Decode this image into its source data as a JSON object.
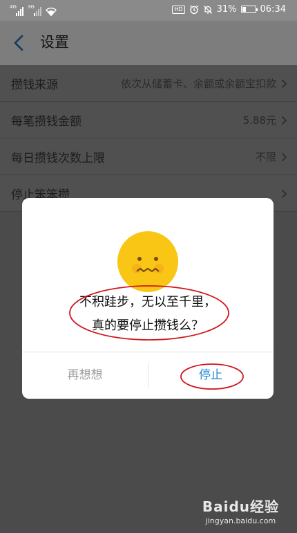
{
  "status_bar": {
    "sim1": "4G",
    "sim2": "3G",
    "hd": "HD",
    "battery_percent": "31%",
    "battery_level": 0.31,
    "time": "06:34"
  },
  "header": {
    "title": "设置"
  },
  "settings": [
    {
      "label": "攒钱来源",
      "value": "依次从储蓄卡、余额或余额宝扣款"
    },
    {
      "label": "每笔攒钱金额",
      "value": "5.88元"
    },
    {
      "label": "每日攒钱次数上限",
      "value": "不限"
    },
    {
      "label": "停止笨笨攒",
      "value": ""
    }
  ],
  "dialog": {
    "message_line1": "不积跬步，无以至千里，",
    "message_line2": "真的要停止攒钱么？",
    "cancel_label": "再想想",
    "confirm_label": "停止"
  },
  "watermark": {
    "logo": "Baidu经验",
    "url": "jingyan.baidu.com"
  },
  "colors": {
    "accent": "#1f86d6",
    "annotation": "#d0161b",
    "emoji_yellow": "#f9c615"
  }
}
